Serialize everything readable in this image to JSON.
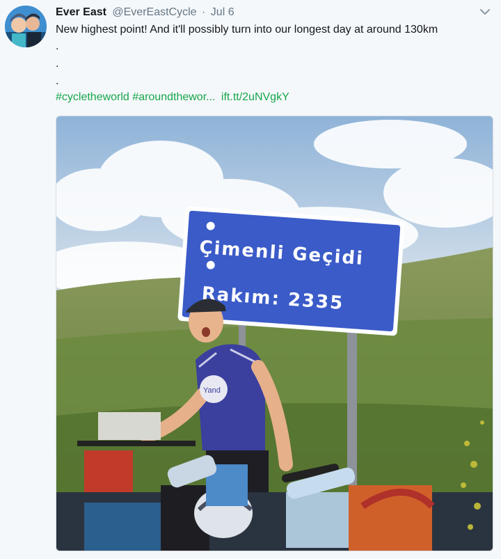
{
  "tweet": {
    "author_name": "Ever East",
    "author_handle": "@EverEastCycle",
    "separator": "·",
    "date": "Jul 6",
    "text_line1": "New highest point! And it'll possibly turn into our longest day at around 130km",
    "dots": [
      ".",
      ".",
      "."
    ],
    "hashtags": "#cycletheworld #aroundthewor...",
    "link": "ift.tt/2uNVgkY"
  },
  "photo": {
    "sign_line1": "Çimenli Geçidi",
    "sign_line2": "Rakım: 2335",
    "shirt_logo": "Yand"
  },
  "icons": {
    "menu": "chevron-down-icon"
  },
  "colors": {
    "link": "#17a64b",
    "sign": "#3a5bc8",
    "shirt": "#3b3f9e"
  }
}
